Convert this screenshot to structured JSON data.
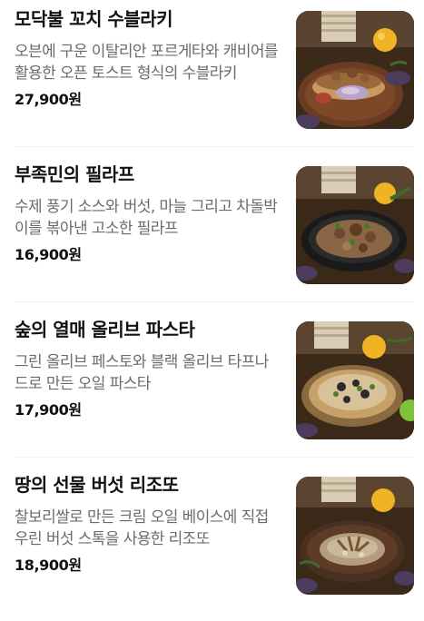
{
  "menu": {
    "items": [
      {
        "name": "모닥불 꼬치 수블라키",
        "description": "오븐에 구운 이탈리안 포르게타와 캐비어를 활용한 오픈 토스트 형식의 수블라키",
        "price": "27,900원",
        "image": "sandwich-photo"
      },
      {
        "name": "부족민의 필라프",
        "description": "수제 풍기 소스와 버섯, 마늘 그리고 차돌박이를 볶아낸 고소한 필라프",
        "price": "16,900원",
        "image": "pilaf-photo"
      },
      {
        "name": "숲의 열매 올리브 파스타",
        "description": "그린 올리브 페스토와 블랙 올리브 타프나드로 만든 오일 파스타",
        "price": "17,900원",
        "image": "pasta-photo"
      },
      {
        "name": "땅의 선물 버섯 리조또",
        "description": "찰보리쌀로 만든 크림 오일 베이스에 직접 우린 버섯 스톡을 사용한 리조또",
        "price": "18,900원",
        "image": "risotto-photo"
      }
    ]
  }
}
